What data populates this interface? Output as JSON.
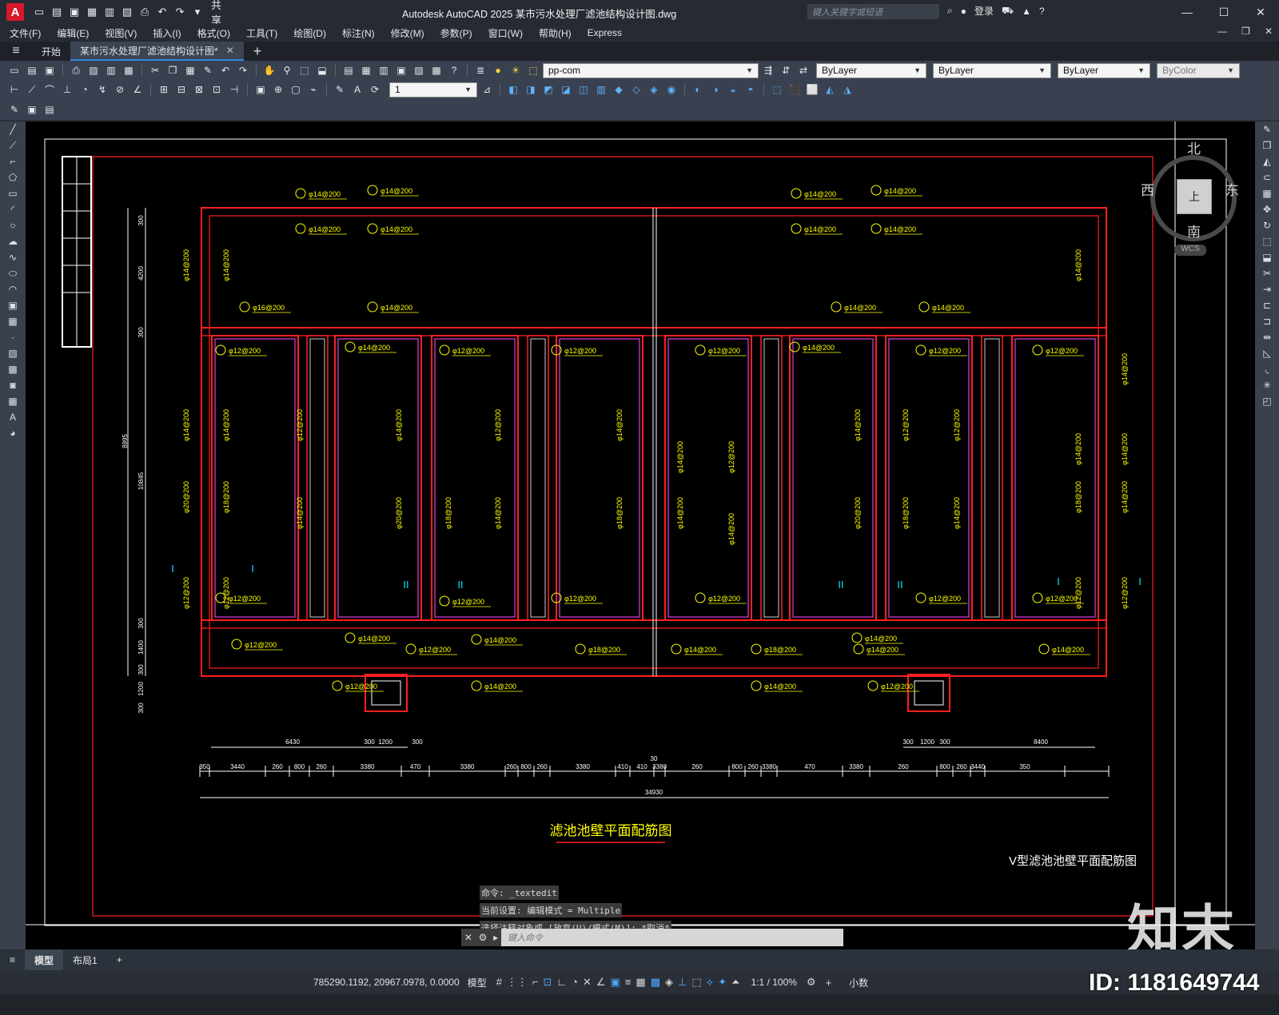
{
  "titlebar": {
    "share_label": "共享",
    "title": "Autodesk AutoCAD 2025    某市污水处理厂滤池结构设计图.dwg",
    "search_placeholder": "键入关键字或短语",
    "signin": "登录"
  },
  "menu": [
    "文件(F)",
    "编辑(E)",
    "视图(V)",
    "插入(I)",
    "格式(O)",
    "工具(T)",
    "绘图(D)",
    "标注(N)",
    "修改(M)",
    "参数(P)",
    "窗口(W)",
    "帮助(H)",
    "Express"
  ],
  "tabs": {
    "start": "开始",
    "active": "某市污水处理厂滤池结构设计图*"
  },
  "layers": {
    "current_layer": "pp-com",
    "color": "ByLayer",
    "linetype": "ByLayer",
    "lineweight": "ByLayer",
    "plotstyle": "ByColor",
    "dim_value": "1"
  },
  "drawing": {
    "main_title": "滤池池壁平面配筋图",
    "subtitle": "V型滤池池壁平面配筋图",
    "dim_total": "34930",
    "dims_row1": [
      "350",
      "3440",
      "260",
      "800",
      "260",
      "3380",
      "470",
      "3380",
      "260",
      "800",
      "260",
      "3380",
      "410",
      "410",
      "3380",
      "260",
      "800",
      "260",
      "3380",
      "470",
      "3380",
      "260",
      "800",
      "260",
      "3440",
      "350"
    ],
    "dim_center": "30",
    "dims_top_left": [
      "6430",
      "300",
      "1200",
      "300"
    ],
    "dims_top_right": [
      "300",
      "1200",
      "300",
      "8400"
    ],
    "vert_dims": [
      "300",
      "4200",
      "300",
      "8995",
      "10845",
      "300",
      "1400",
      "300",
      "1200",
      "300"
    ],
    "rebar_labels": [
      "φ14@200",
      "φ12@200",
      "φ16@200",
      "φ20@200",
      "φ18@200"
    ],
    "section_marks": [
      "I",
      "II"
    ],
    "compass": {
      "north": "北",
      "south": "南",
      "east": "东",
      "west": "西",
      "top": "上",
      "wcs": "WCS"
    }
  },
  "command": {
    "history": [
      "命令: _textedit",
      "当前设置: 编辑模式 = Multiple",
      "选择注释对象或 [放弃(U)/模式(M)]: *取消*"
    ],
    "placeholder": "键入命令"
  },
  "layout_tabs": [
    "模型",
    "布局1"
  ],
  "status": {
    "coords": "785290.1192, 20967.0978, 0.0000",
    "model": "模型",
    "scale": "1:1 / 100%",
    "units": "小数"
  },
  "overlay": {
    "logo": "知末",
    "id": "ID: 1181649744"
  },
  "colors": {
    "red": "#ff2020",
    "magenta": "#e040e0",
    "yellow": "#ffff00",
    "white": "#ffffff",
    "cyan": "#00e5ff"
  }
}
